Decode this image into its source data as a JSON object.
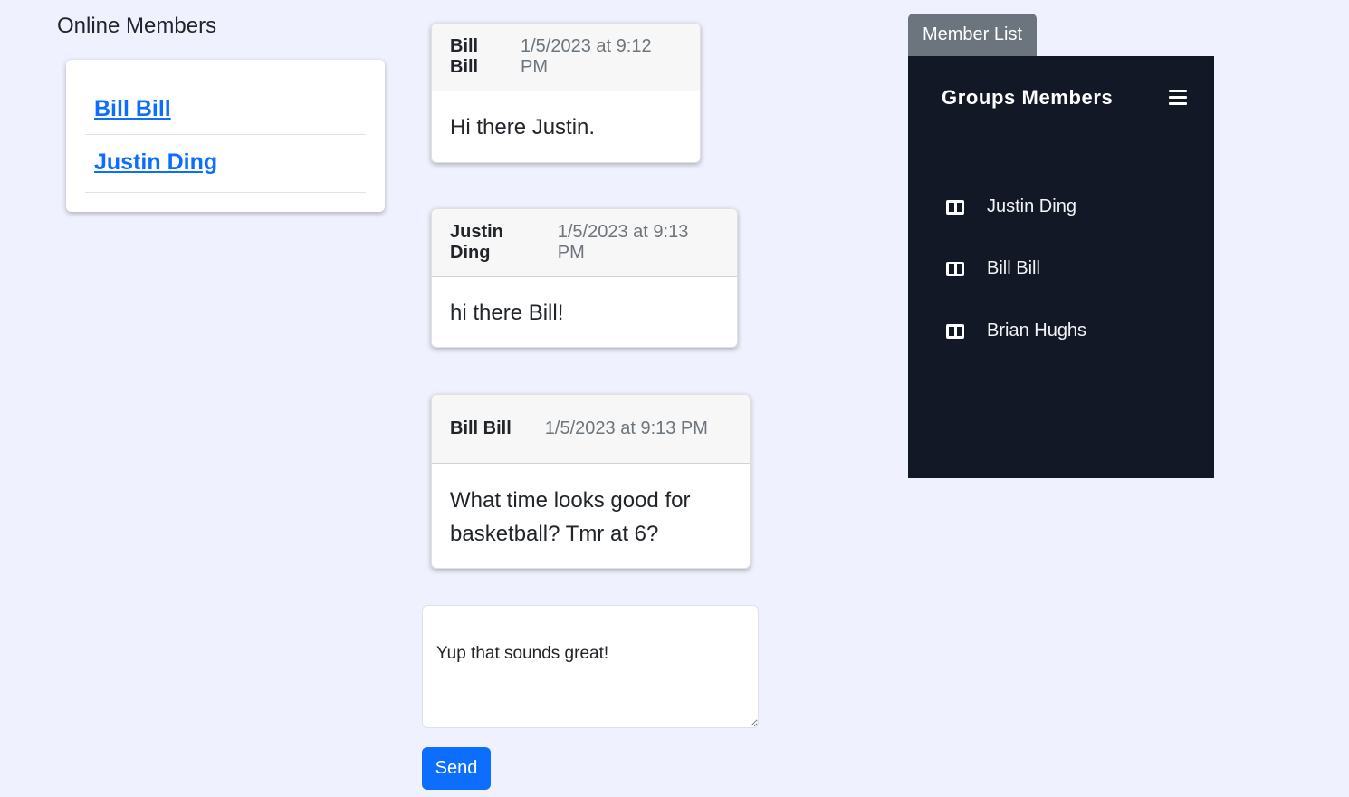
{
  "online": {
    "title": "Online Members",
    "members": [
      "Bill Bill",
      "Justin Ding"
    ]
  },
  "messages": [
    {
      "author": "Bill Bill",
      "time": "1/5/2023 at 9:12 PM",
      "text": "Hi there Justin."
    },
    {
      "author": "Justin Ding",
      "time": "1/5/2023 at 9:13 PM",
      "text": "hi there Bill!"
    },
    {
      "author": "Bill Bill",
      "time": "1/5/2023 at 9:13 PM",
      "text": "What time looks good for basketball? Tmr at 6?"
    }
  ],
  "compose": {
    "value": "Yup that sounds great!",
    "send_label": "Send"
  },
  "sidebar": {
    "toggle_label": "Member List",
    "title": "Groups Members",
    "members": [
      "Justin Ding",
      "Bill Bill",
      "Brian Hughs"
    ]
  },
  "colors": {
    "page_bg": "#eff1fe",
    "link": "#0d6efd",
    "primary_button": "#0d6efd",
    "secondary_button": "#6c757d",
    "sidebar_bg": "#131827"
  },
  "icons": {
    "sidebar_member": "columns-icon",
    "sidebar_menu": "hamburger-menu-icon"
  }
}
